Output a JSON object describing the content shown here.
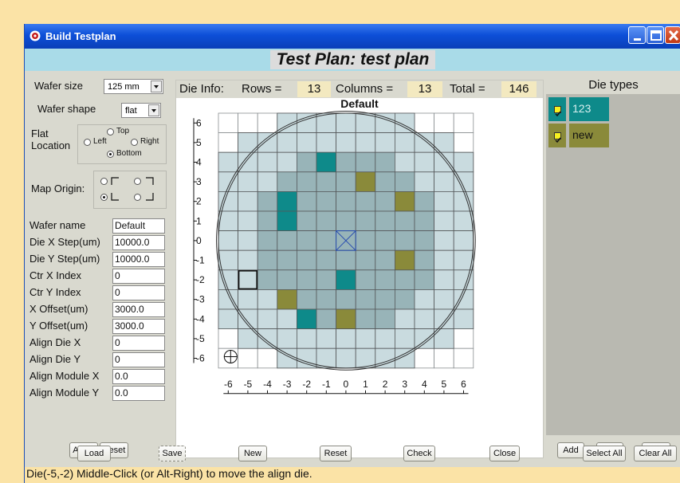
{
  "window": {
    "title": "Build Testplan",
    "heading": "Test Plan: test plan"
  },
  "left": {
    "wafer_size_label": "Wafer size",
    "wafer_size_value": "125 mm",
    "wafer_shape_label": "Wafer shape",
    "wafer_shape_value": "flat",
    "flat_location_label": "Flat Location",
    "flat_options": {
      "top": "Top",
      "left": "Left",
      "right": "Right",
      "bottom": "Bottom"
    },
    "flat_selected": "Bottom",
    "map_origin_label": "Map Origin:",
    "map_origin_selected": "bottom-left",
    "fields": [
      {
        "label": "Wafer name",
        "value": "Default"
      },
      {
        "label": "Die X Step(um)",
        "value": "10000.0"
      },
      {
        "label": "Die Y Step(um)",
        "value": "10000.0"
      },
      {
        "label": "Ctr X Index",
        "value": "0"
      },
      {
        "label": "Ctr Y Index",
        "value": "0"
      },
      {
        "label": "X Offset(um)",
        "value": "3000.0"
      },
      {
        "label": "Y Offset(um)",
        "value": "3000.0"
      },
      {
        "label": "Align Die X",
        "value": "0"
      },
      {
        "label": "Align Die Y",
        "value": "0"
      },
      {
        "label": "Align Module X",
        "value": "0.0"
      },
      {
        "label": "Align Module Y",
        "value": "0.0"
      }
    ],
    "apply_label": "Apply",
    "reset_label": "Reset"
  },
  "info": {
    "die_info_label": "Die Info:",
    "rows_label": "Rows =",
    "rows": "13",
    "columns_label": "Columns =",
    "columns": "13",
    "total_label": "Total =",
    "total": "146"
  },
  "map": {
    "title": "Default",
    "x_ticks": [
      "-6",
      "-5",
      "-4",
      "-3",
      "-2",
      "-1",
      "0",
      "1",
      "2",
      "3",
      "4",
      "5",
      "6"
    ],
    "y_ticks": [
      "6",
      "5",
      "4",
      "3",
      "2",
      "1",
      "0",
      "-1",
      "-2",
      "-3",
      "-4",
      "-5",
      "-6"
    ],
    "colors": {
      "outer_die": "#c9dbdf",
      "inner_die": "#98b4b8",
      "grid_line": "#55585a",
      "type_123": "#0e8a8a",
      "type_new": "#8a8a3a"
    },
    "row_spans": [
      {
        "y": 6,
        "x_min": -3,
        "x_max": 3
      },
      {
        "y": 5,
        "x_min": -5,
        "x_max": 5
      },
      {
        "y": 4,
        "x_min": -6,
        "x_max": 6
      },
      {
        "y": 3,
        "x_min": -6,
        "x_max": 6
      },
      {
        "y": 2,
        "x_min": -6,
        "x_max": 6
      },
      {
        "y": 1,
        "x_min": -6,
        "x_max": 6
      },
      {
        "y": 0,
        "x_min": -6,
        "x_max": 6
      },
      {
        "y": -1,
        "x_min": -6,
        "x_max": 6
      },
      {
        "y": -2,
        "x_min": -6,
        "x_max": 6
      },
      {
        "y": -3,
        "x_min": -6,
        "x_max": 6
      },
      {
        "y": -4,
        "x_min": -6,
        "x_max": 6
      },
      {
        "y": -5,
        "x_min": -5,
        "x_max": 5
      },
      {
        "y": -6,
        "x_min": -3,
        "x_max": 3
      }
    ],
    "typed_dies": [
      {
        "x": -1,
        "y": 4,
        "type": "123"
      },
      {
        "x": -3,
        "y": 2,
        "type": "123"
      },
      {
        "x": -3,
        "y": 1,
        "type": "123"
      },
      {
        "x": 0,
        "y": -2,
        "type": "123"
      },
      {
        "x": -2,
        "y": -4,
        "type": "123"
      },
      {
        "x": 1,
        "y": 3,
        "type": "new"
      },
      {
        "x": 3,
        "y": 2,
        "type": "new"
      },
      {
        "x": 3,
        "y": -1,
        "type": "new"
      },
      {
        "x": -3,
        "y": -3,
        "type": "new"
      },
      {
        "x": 0,
        "y": -4,
        "type": "new"
      }
    ],
    "selected_die": {
      "x": -5,
      "y": -2
    },
    "center_die": {
      "x": 0,
      "y": 0
    }
  },
  "die_types": {
    "header": "Die types",
    "items": [
      {
        "name": "123",
        "color": "#0e8a8a",
        "checked": true
      },
      {
        "name": "new",
        "color": "#8a8a3a",
        "checked": true
      }
    ],
    "add_label": "Add",
    "all_label": "All",
    "none_label": "None"
  },
  "bottom": {
    "load": "Load",
    "save": "Save",
    "new": "New",
    "reset": "Reset",
    "check": "Check",
    "close": "Close",
    "select_all": "Select All",
    "clear_all": "Clear All"
  },
  "status": "Die(-5,-2) Middle-Click (or Alt-Right) to move the align die."
}
